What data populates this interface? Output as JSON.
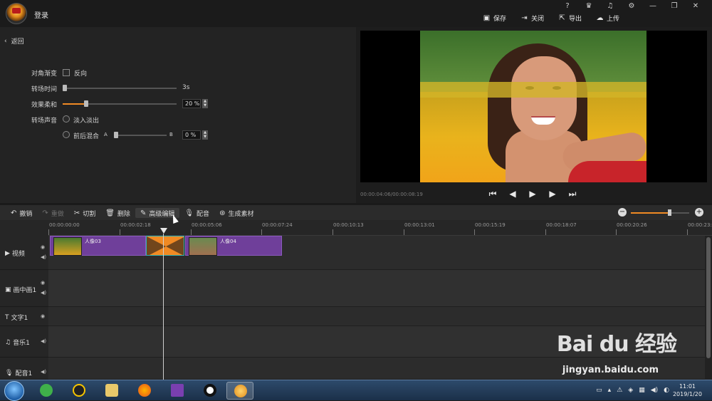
{
  "app": {
    "login": "登录",
    "window_icons": [
      "?",
      "VIP",
      "bell-icon",
      "gear-icon",
      "—",
      "❐",
      "✕"
    ]
  },
  "toolbar": {
    "save": "保存",
    "close": "关闭",
    "export": "导出",
    "upload": "上传"
  },
  "settings": {
    "back": "返回",
    "diagonal_fade_label": "对角渐变",
    "reverse_label": "反向",
    "transition_time_label": "转场时间",
    "transition_time_value": "3s",
    "softness_label": "效果柔和",
    "softness_value": "20 %",
    "softness_level": 0.2,
    "transition_sound_label": "转场声音",
    "fade_in_out": "淡入淡出",
    "cross_mix": "前后混合",
    "mix_a": "A",
    "mix_b": "B",
    "mix_value": "0 %"
  },
  "preview": {
    "timecode": "00:00:04:06/00:00:08:19"
  },
  "edit_toolbar": {
    "undo": "撤销",
    "redo": "重做",
    "cut": "切割",
    "delete": "删除",
    "advanced_edit": "高级编辑",
    "dub": "配音",
    "generate": "生成素材"
  },
  "ruler": {
    "ticks": [
      "00:00:00:00",
      "00:00:02:18",
      "00:00:05:06",
      "00:00:07:24",
      "00:00:10:13",
      "00:00:13:01",
      "00:00:15:19",
      "00:00:18:07",
      "00:00:20:26",
      "00:00:23:"
    ]
  },
  "tracks": {
    "video": "视频",
    "pip": "画中画1",
    "text": "文字1",
    "music": "音乐1",
    "voice": "配音1"
  },
  "clips": {
    "clip1": "人像03",
    "clip2": "人像04"
  },
  "taskbar": {
    "time": "11:01",
    "date": "2019/1/20"
  },
  "watermark": {
    "brand": "Bai du 经验",
    "url": "jingyan.baidu.com"
  }
}
